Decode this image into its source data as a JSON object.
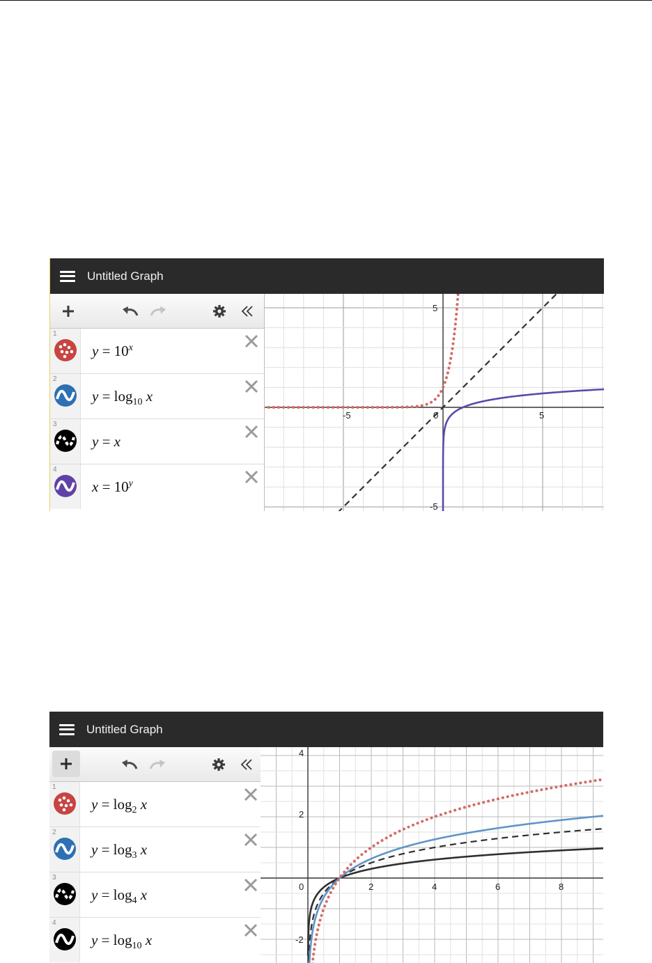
{
  "graph1": {
    "title": "Untitled Graph",
    "expressions": [
      {
        "num": "1",
        "lhs": "y",
        "rhs": "10",
        "sup": "x",
        "color": "#c74440",
        "style": "dotted"
      },
      {
        "num": "2",
        "lhs": "y",
        "rhs": "log",
        "sub": "10",
        "arg": "x",
        "color": "#2d70b3",
        "style": "solid"
      },
      {
        "num": "3",
        "lhs": "y",
        "arg": "x",
        "color": "#000000",
        "style": "dashed"
      },
      {
        "num": "4",
        "lhs": "x",
        "rhs": "10",
        "sup": "y",
        "color": "#6042a6",
        "style": "solid"
      }
    ],
    "axis_labels": {
      "x_neg": "-5",
      "origin": "0",
      "x_pos": "5",
      "y_pos": "5",
      "y_neg": "-5"
    }
  },
  "graph2": {
    "title": "Untitled Graph",
    "expressions": [
      {
        "num": "1",
        "lhs": "y",
        "rhs": "log",
        "sub": "2",
        "arg": "x",
        "color": "#c74440",
        "style": "dotted"
      },
      {
        "num": "2",
        "lhs": "y",
        "rhs": "log",
        "sub": "3",
        "arg": "x",
        "color": "#2d70b3",
        "style": "solid"
      },
      {
        "num": "3",
        "lhs": "y",
        "rhs": "log",
        "sub": "4",
        "arg": "x",
        "color": "#000000",
        "style": "dashed"
      },
      {
        "num": "4",
        "lhs": "y",
        "rhs": "log",
        "sub": "10",
        "arg": "x",
        "color": "#000000",
        "style": "solid"
      }
    ],
    "axis_labels": {
      "origin": "0",
      "x2": "2",
      "x4": "4",
      "x6": "6",
      "x8": "8",
      "y4": "4",
      "y2": "2",
      "yn2": "-2"
    }
  },
  "icons": {
    "menu": "hamburger-icon",
    "add": "plus-icon",
    "undo": "undo-icon",
    "redo": "redo-icon",
    "settings": "gear-icon",
    "collapse": "double-chevron-left-icon",
    "delete": "close-icon"
  }
}
